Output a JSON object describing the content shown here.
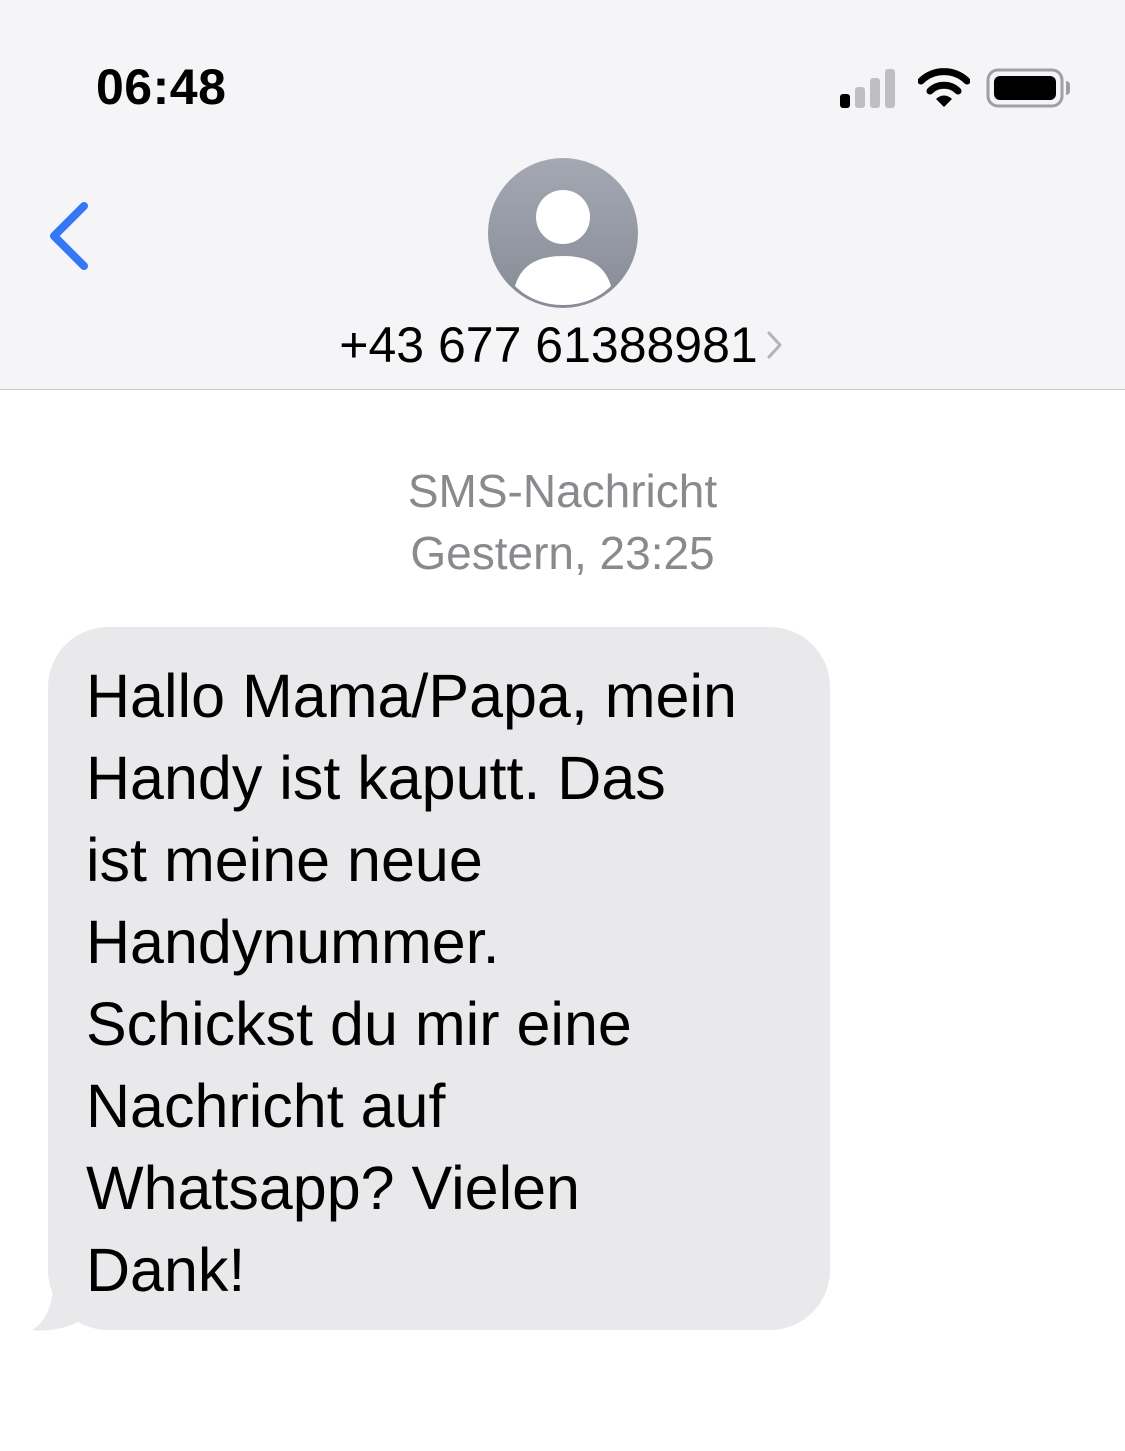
{
  "status_bar": {
    "time": "06:48",
    "icons": [
      "signal-icon",
      "wifi-icon",
      "battery-icon"
    ]
  },
  "header": {
    "back_icon": "chevron-left-icon",
    "avatar_icon": "person-silhouette-icon",
    "contact_number": "+43 677 61388981",
    "contact_chevron_icon": "chevron-right-icon"
  },
  "conversation": {
    "service_label": "SMS-Nachricht",
    "timestamp": "Gestern, 23:25",
    "messages": [
      {
        "direction": "incoming",
        "lines": [
          "Hallo Mama/Papa, mein",
          "Handy ist kaputt. Das",
          "ist meine neue",
          "Handynummer.",
          "Schickst du mir eine",
          "Nachricht auf",
          "Whatsapp? Vielen",
          "Dank!"
        ]
      }
    ]
  },
  "colors": {
    "header_background": "#f5f5f7",
    "accent_blue": "#3478f6",
    "incoming_bubble": "#e9e9eb",
    "meta_text": "#8a8a8e"
  }
}
